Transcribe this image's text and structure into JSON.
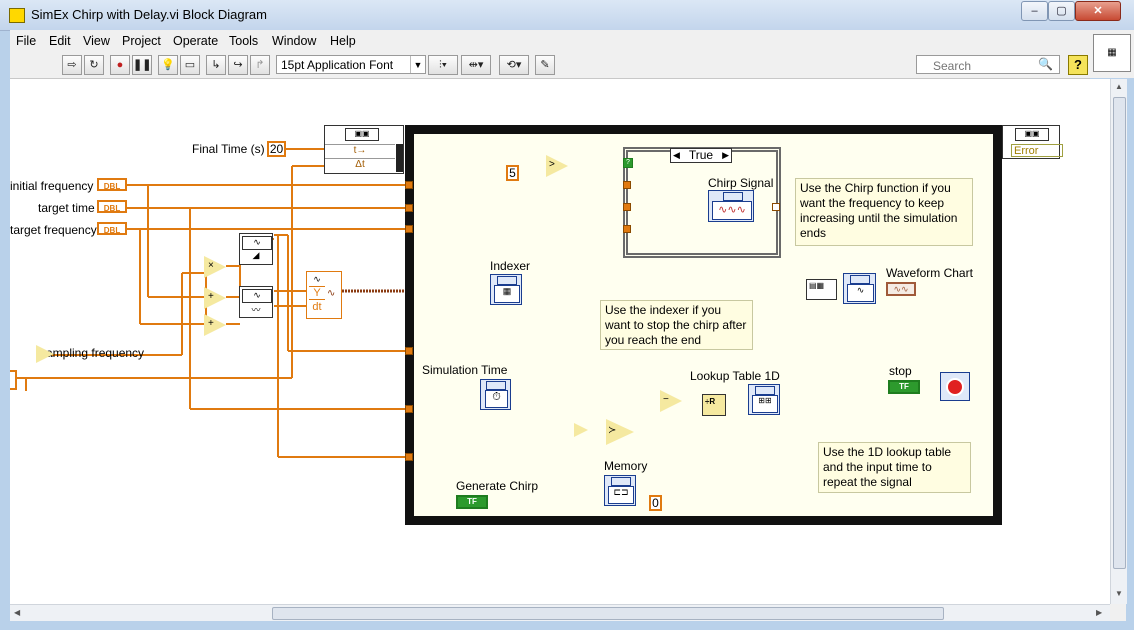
{
  "window": {
    "title": "SimEx Chirp with Delay.vi Block Diagram"
  },
  "menu": {
    "items": [
      "File",
      "Edit",
      "View",
      "Project",
      "Operate",
      "Tools",
      "Window",
      "Help"
    ]
  },
  "toolbar": {
    "font": "15pt Application Font",
    "search_placeholder": "Search"
  },
  "diagram": {
    "inputs": {
      "final_time_label": "Final Time (s)",
      "final_time_value": "20",
      "initial_frequency_label": "initial frequency",
      "target_time_label": "target time",
      "target_frequency_label": "target frequency",
      "sampling_frequency_label": "sampling frequency",
      "dbl_tag": "DBL"
    },
    "loop": {
      "constant_five": "5",
      "case_selector": "True",
      "chirp_signal_label": "Chirp Signal",
      "indexer_label": "Indexer",
      "simulation_time_label": "Simulation Time",
      "lookup_table_label": "Lookup Table 1D",
      "memory_label": "Memory",
      "memory_init": "0",
      "generate_chirp_label": "Generate Chirp",
      "waveform_chart_label": "Waveform Chart",
      "stop_label": "stop",
      "tf_tag": "TF",
      "wave_y_label": "Y",
      "wave_dt_label": "dt",
      "error_label": "Error"
    },
    "notes": [
      "Use the Chirp function if you want the frequency to keep increasing until the simulation ends",
      "Use the indexer if you want to stop the chirp after you reach the end",
      "Use the 1D lookup table and the input time to repeat the signal"
    ],
    "colors": {
      "double_wire": "#e07a10",
      "boolean_wire": "#1f7d1f",
      "loop_border": "#111111",
      "note_background": "#fffde1"
    }
  }
}
